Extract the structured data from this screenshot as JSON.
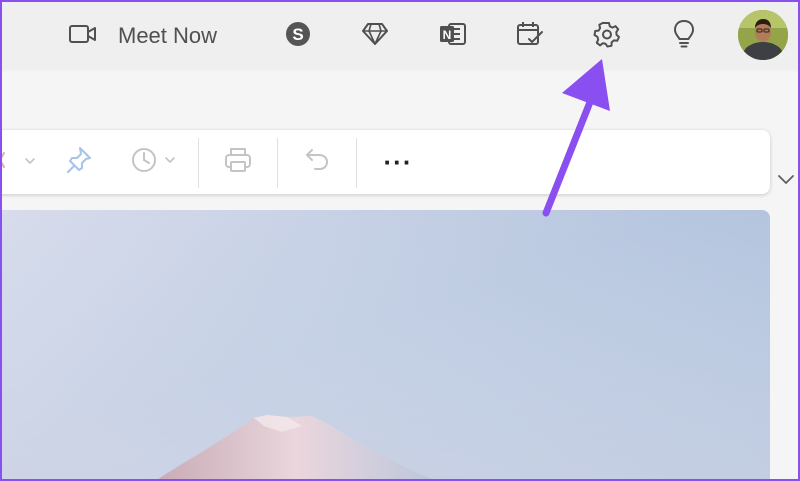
{
  "header": {
    "video_icon": "video-camera-icon",
    "meet_now_label": "Meet Now",
    "icons": [
      "skype-icon",
      "diamond-icon",
      "onenote-icon",
      "calendar-check-icon",
      "gear-icon",
      "lightbulb-icon"
    ],
    "avatar": "user-avatar"
  },
  "toolbar": {
    "icons": [
      "flag-icon",
      "pin-icon",
      "clock-icon",
      "print-icon",
      "undo-icon"
    ],
    "more_label": "···"
  },
  "colors": {
    "accent_arrow": "#8a4ff0",
    "header_bg": "#efefef",
    "toolbar_bg": "#ffffff",
    "icon_color": "#505050",
    "pale_icon": "#a8c2e8"
  }
}
